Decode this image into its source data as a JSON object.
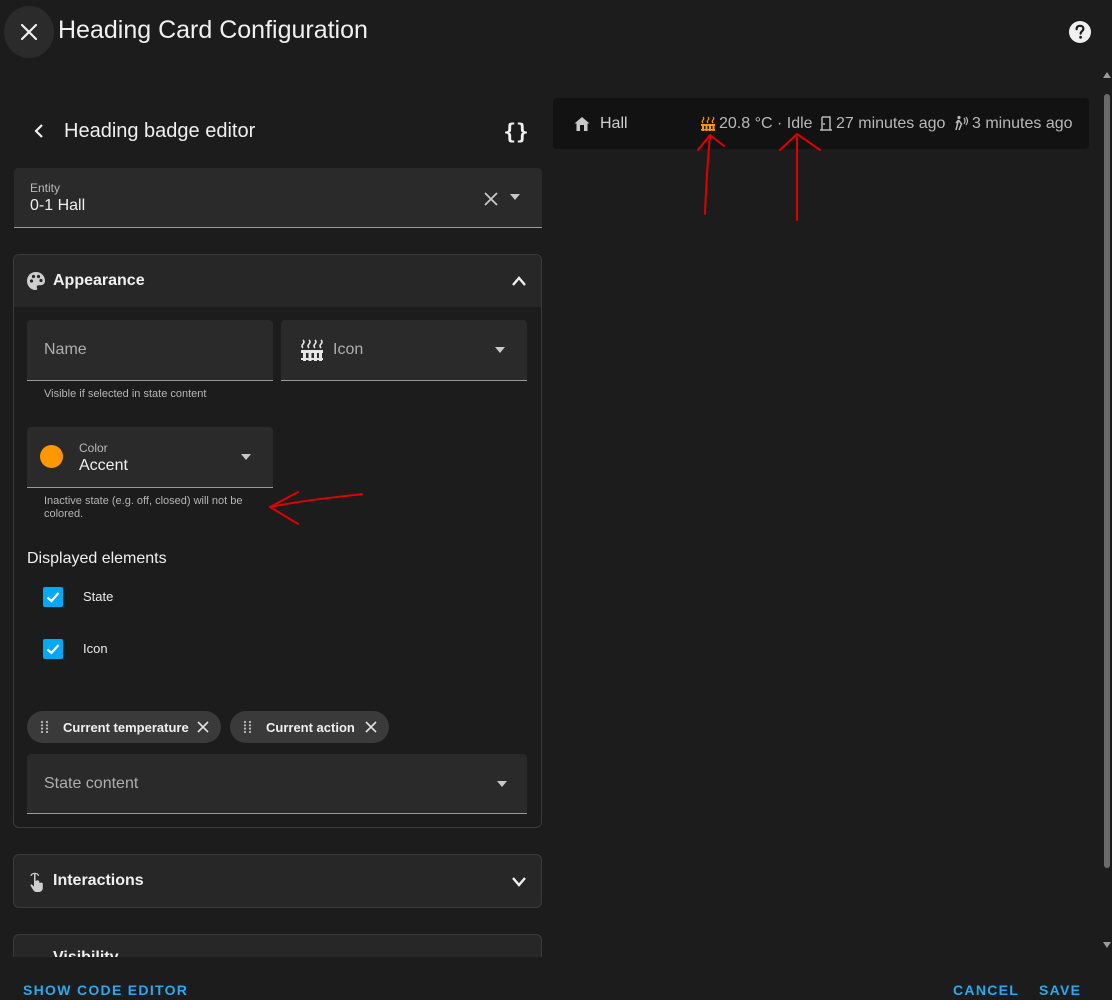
{
  "dialog": {
    "title": "Heading Card Configuration",
    "close_icon": "close-icon",
    "help_icon": "help-circle-icon"
  },
  "editor": {
    "title": "Heading badge editor",
    "back_icon": "chevron-left-icon",
    "code_toggle": "{}",
    "entity": {
      "label": "Entity",
      "value": "0-1 Hall"
    },
    "appearance": {
      "title": "Appearance",
      "icon": "palette-icon",
      "name_placeholder": "Name",
      "name_helper": "Visible if selected in state content",
      "icon_field_text": "Icon",
      "icon_field_glyph": "radiator-icon",
      "color": {
        "label": "Color",
        "value": "Accent",
        "swatch": "#ff9800"
      },
      "color_helper": "Inactive state (e.g. off, closed) will not be colored.",
      "displayed_elements_title": "Displayed elements",
      "checkboxes": [
        {
          "label": "State",
          "checked": true
        },
        {
          "label": "Icon",
          "checked": true
        }
      ],
      "chips": [
        "Current temperature",
        "Current action"
      ],
      "state_content_placeholder": "State content"
    },
    "interactions": {
      "title": "Interactions",
      "icon": "gesture-tap-icon"
    },
    "visibility": {
      "title": "Visibility"
    }
  },
  "preview": {
    "title": "Hall",
    "badges": [
      {
        "icon": "radiator-icon",
        "text": "20.8 °C · Idle"
      },
      {
        "icon": "door-icon",
        "text": "27 minutes ago"
      },
      {
        "icon": "motion-sensor-icon",
        "text": "3 minutes ago"
      }
    ]
  },
  "footer": {
    "show_code_editor": "SHOW CODE EDITOR",
    "cancel": "CANCEL",
    "save": "SAVE"
  },
  "colors": {
    "accent": "#ff9800",
    "primary": "#03a9f4",
    "link": "#2aa9f2",
    "annotation": "#e00000"
  }
}
